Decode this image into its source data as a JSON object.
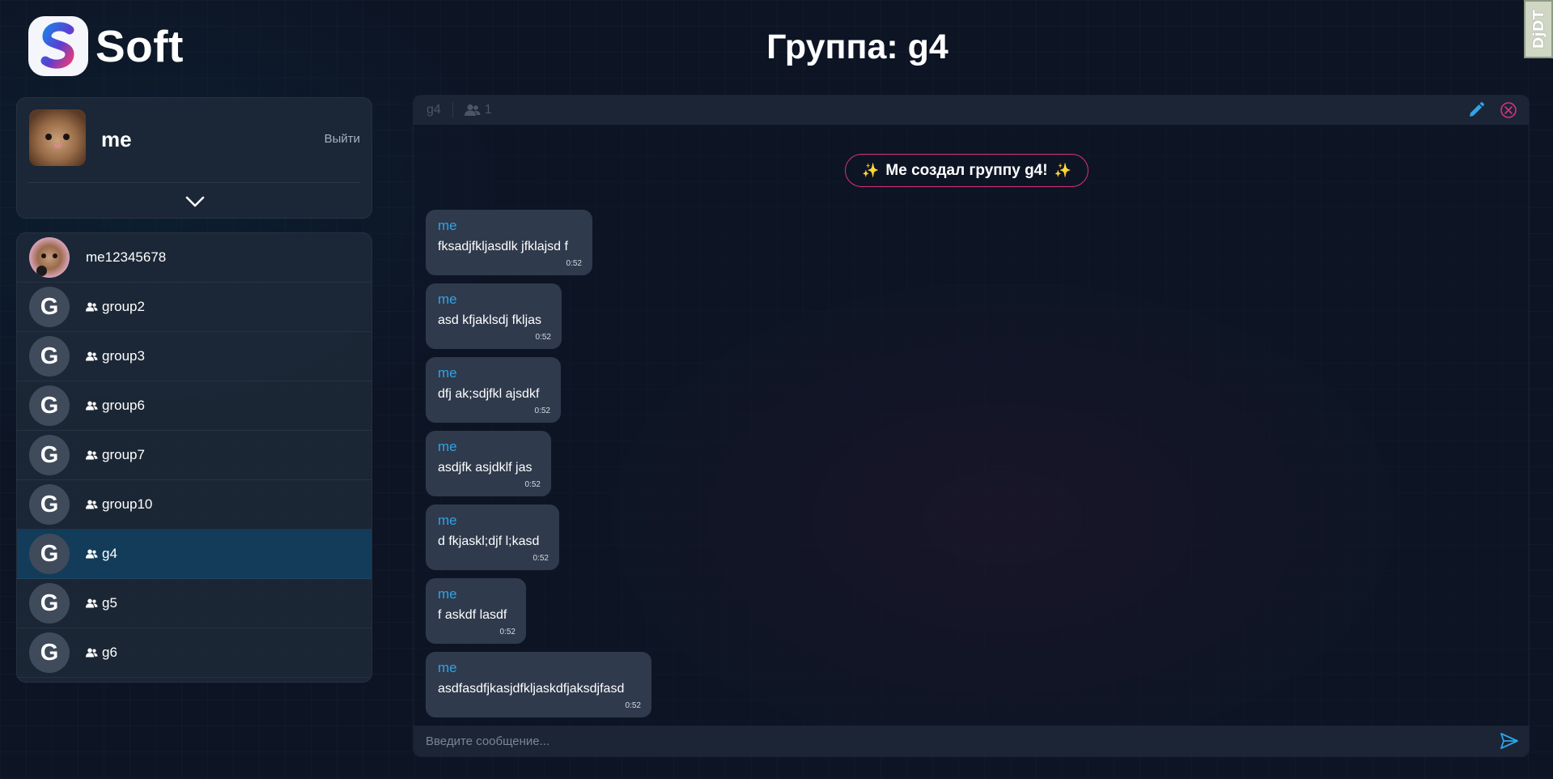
{
  "app": {
    "logo_text": "Soft",
    "logo_icon": "s-logo-icon",
    "page_title": "Группа: g4",
    "debug_toolbar_label": "DjDT"
  },
  "profile": {
    "name": "me",
    "logout_label": "Выйти",
    "toggle_icon": "chevron-down-icon"
  },
  "chats": [
    {
      "name": "me12345678",
      "type": "user",
      "avatar": "photo"
    },
    {
      "name": "group2",
      "type": "group",
      "avatar": "G"
    },
    {
      "name": "group3",
      "type": "group",
      "avatar": "G"
    },
    {
      "name": "group6",
      "type": "group",
      "avatar": "G"
    },
    {
      "name": "group7",
      "type": "group",
      "avatar": "G"
    },
    {
      "name": "group10",
      "type": "group",
      "avatar": "G"
    },
    {
      "name": "g4",
      "type": "group",
      "avatar": "G",
      "active": true
    },
    {
      "name": "g5",
      "type": "group",
      "avatar": "G"
    },
    {
      "name": "g6",
      "type": "group",
      "avatar": "G"
    }
  ],
  "chat": {
    "name": "g4",
    "members_count": "1",
    "system_message": "Me создал группу g4!",
    "input_placeholder": "Введите сообщение...",
    "messages": [
      {
        "author": "me",
        "text": "fksadjfkljasdlk jfklajsd f",
        "time": "0:52"
      },
      {
        "author": "me",
        "text": "asd kfjaklsdj fkljas",
        "time": "0:52"
      },
      {
        "author": "me",
        "text": "dfj ak;sdjfkl ajsdkf",
        "time": "0:52"
      },
      {
        "author": "me",
        "text": "asdjfk asjdklf jas",
        "time": "0:52"
      },
      {
        "author": "me",
        "text": "d fkjaskl;djf l;kasd",
        "time": "0:52"
      },
      {
        "author": "me",
        "text": "f askdf lasdf",
        "time": "0:52"
      },
      {
        "author": "me",
        "text": "asdfasdfjkasjdfkljaskdfjaksdjfasd",
        "time": "0:52"
      }
    ]
  },
  "colors": {
    "accent": "#2fa4e7",
    "active_chat": "#123c5a",
    "system_border": "#d8327a",
    "close": "#d8327a"
  }
}
